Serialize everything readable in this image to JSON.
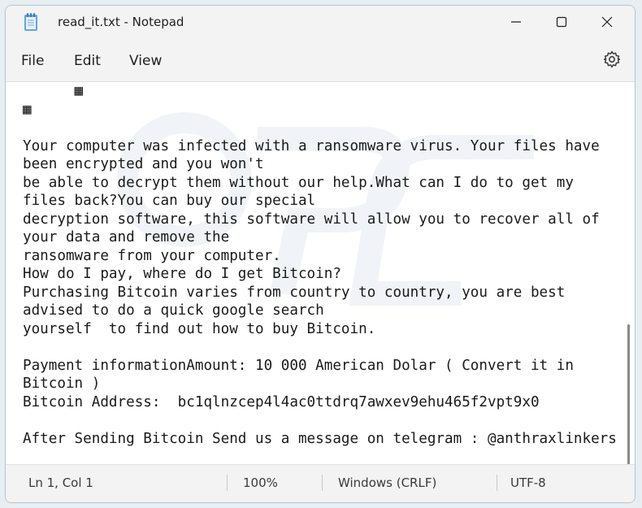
{
  "window": {
    "title": "read_it.txt - Notepad",
    "icons": {
      "app": "notepad-icon",
      "minimize": "minimize-icon",
      "maximize": "maximize-icon",
      "close": "close-icon",
      "settings": "gear-icon"
    }
  },
  "menu": {
    "file": "File",
    "edit": "Edit",
    "view": "View"
  },
  "document": {
    "content": "      ▦\n▦\n\nYour computer was infected with a ransomware virus. Your files have\nbeen encrypted and you won't\nbe able to decrypt them without our help.What can I do to get my\nfiles back?You can buy our special\ndecryption software, this software will allow you to recover all of\nyour data and remove the\nransomware from your computer.\nHow do I pay, where do I get Bitcoin?\nPurchasing Bitcoin varies from country to country, you are best\nadvised to do a quick google search\nyourself  to find out how to buy Bitcoin.\n\nPayment informationAmount: 10 000 American Dolar ( Convert it in\nBitcoin )\nBitcoin Address:  bc1qlnzcep4l4ac0ttdrq7awxev9ehu465f2vpt9x0\n\nAfter Sending Bitcoin Send us a message on telegram : @anthraxlinkers"
  },
  "status": {
    "position": "Ln 1, Col 1",
    "zoom": "100%",
    "line_ending": "Windows (CRLF)",
    "encoding": "UTF-8"
  }
}
